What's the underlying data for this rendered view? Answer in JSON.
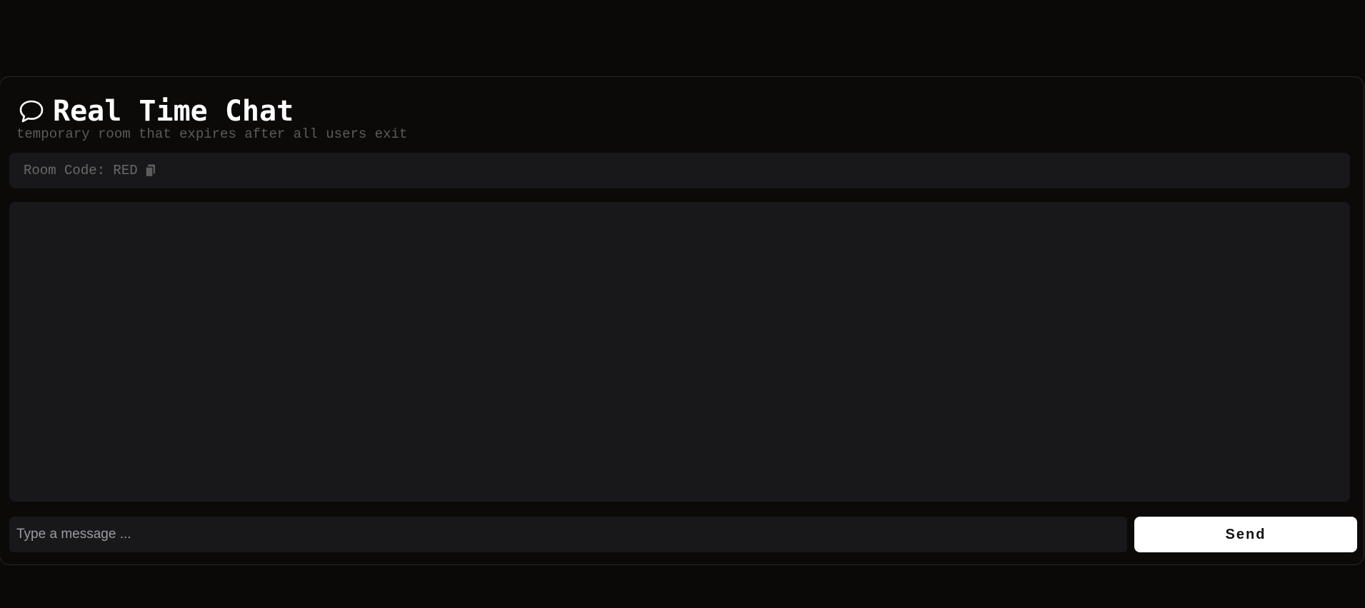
{
  "header": {
    "title": "Real Time Chat",
    "subtitle": "temporary room that expires after all users exit",
    "icon": "chat-bubble-icon"
  },
  "room": {
    "label": "Room Code: RED",
    "copy_icon": "copy-icon"
  },
  "composer": {
    "placeholder": "Type a message ...",
    "value": "",
    "send_label": "Send"
  },
  "messages": [],
  "colors": {
    "background": "#0a0908",
    "panel": "#18181b",
    "accent": "#ffffff",
    "muted_text": "#5c5b59"
  }
}
